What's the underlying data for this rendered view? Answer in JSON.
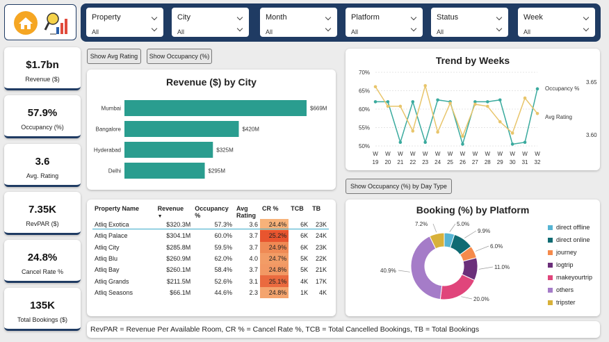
{
  "filters": [
    {
      "label": "Property",
      "value": "All"
    },
    {
      "label": "City",
      "value": "All"
    },
    {
      "label": "Month",
      "value": "All"
    },
    {
      "label": "Platform",
      "value": "All"
    },
    {
      "label": "Status",
      "value": "All"
    },
    {
      "label": "Week",
      "value": "All"
    }
  ],
  "kpis": [
    {
      "value": "$1.7bn",
      "label": "Revenue ($)"
    },
    {
      "value": "57.9%",
      "label": "Occupancy (%)"
    },
    {
      "value": "3.6",
      "label": "Avg. Rating"
    },
    {
      "value": "7.35K",
      "label": "RevPAR ($)"
    },
    {
      "value": "24.8%",
      "label": "Cancel Rate %"
    },
    {
      "value": "135K",
      "label": "Total Bookings ($)"
    }
  ],
  "buttons": {
    "avg_rating": "Show Avg Rating",
    "occupancy": "Show Occupancy (%)",
    "occ_day_type": "Show Occupancy (%) by Day Type"
  },
  "city_chart": {
    "title": "Revenue ($) by City",
    "chart_data": {
      "type": "bar",
      "categories": [
        "Mumbai",
        "Bangalore",
        "Hyderabad",
        "Delhi"
      ],
      "values": [
        669,
        420,
        325,
        295
      ],
      "labels": [
        "$669M",
        "$420M",
        "$325M",
        "$295M"
      ],
      "color": "#2a9d8f"
    }
  },
  "trend_chart": {
    "title": "Trend by Weeks",
    "chart_data": {
      "type": "line",
      "x": [
        "W 19",
        "W 20",
        "W 21",
        "W 22",
        "W 23",
        "W 24",
        "W 25",
        "W 26",
        "W 27",
        "W 28",
        "W 29",
        "W 30",
        "W 31",
        "W 32"
      ],
      "y_left_ticks": [
        "70%",
        "65%",
        "60%",
        "55%",
        "50%"
      ],
      "y_right_ticks": [
        "3.65",
        "3.60"
      ],
      "series": [
        {
          "name": "Occupancy %",
          "color": "#3aaa9e",
          "values": [
            62,
            62,
            51,
            62,
            51,
            62.5,
            62,
            50.5,
            62,
            62,
            62.5,
            50.5,
            51,
            65.5
          ]
        },
        {
          "name": "Avg Rating",
          "color": "#e8c56b",
          "values": [
            3.652,
            3.633,
            3.633,
            3.609,
            3.653,
            3.608,
            3.636,
            3.604,
            3.635,
            3.633,
            3.618,
            3.607,
            3.641,
            3.626
          ]
        }
      ]
    }
  },
  "property_table": {
    "headers": [
      "Property Name",
      "Revenue",
      "Occupancy %",
      "Avg Rating",
      "CR %",
      "TCB",
      "TB"
    ],
    "rows": [
      [
        "Atliq Exotica",
        "$320.3M",
        "57.3%",
        "3.6",
        "24.4%",
        "6K",
        "23K"
      ],
      [
        "Atliq Palace",
        "$304.1M",
        "60.0%",
        "3.7",
        "25.2%",
        "6K",
        "24K"
      ],
      [
        "Atliq City",
        "$285.8M",
        "59.5%",
        "3.7",
        "24.9%",
        "6K",
        "23K"
      ],
      [
        "Atliq Blu",
        "$260.9M",
        "62.0%",
        "4.0",
        "24.7%",
        "5K",
        "22K"
      ],
      [
        "Atliq Bay",
        "$260.1M",
        "58.4%",
        "3.7",
        "24.8%",
        "5K",
        "21K"
      ],
      [
        "Atliq Grands",
        "$211.5M",
        "52.6%",
        "3.1",
        "25.1%",
        "4K",
        "17K"
      ],
      [
        "Atliq Seasons",
        "$66.1M",
        "44.6%",
        "2.3",
        "24.8%",
        "1K",
        "4K"
      ]
    ],
    "cr_colors": [
      "#f7b27a",
      "#e8552f",
      "#ef8a55",
      "#f29c66",
      "#f29864",
      "#ea6a3f",
      "#f4a46e"
    ]
  },
  "platform_chart": {
    "title": "Booking (%) by Platform",
    "chart_data": {
      "type": "pie",
      "categories": [
        "direct offline",
        "direct online",
        "journey",
        "logtrip",
        "makeyourtrip",
        "others",
        "tripster"
      ],
      "values": [
        5.0,
        9.9,
        6.0,
        11.0,
        20.0,
        40.9,
        7.2
      ],
      "labels": [
        "5.0%",
        "9.9%",
        "6.0%",
        "11.0%",
        "20.0%",
        "40.9%",
        "7.2%"
      ],
      "colors": [
        "#56b4d3",
        "#0f6b73",
        "#f58a4b",
        "#6b2f7a",
        "#e0457b",
        "#a57cc8",
        "#d8b13a"
      ]
    }
  },
  "footer_note": "RevPAR = Revenue Per Available Room, CR % = Cancel Rate %, TCB = Total Cancelled Bookings, TB = Total Bookings"
}
